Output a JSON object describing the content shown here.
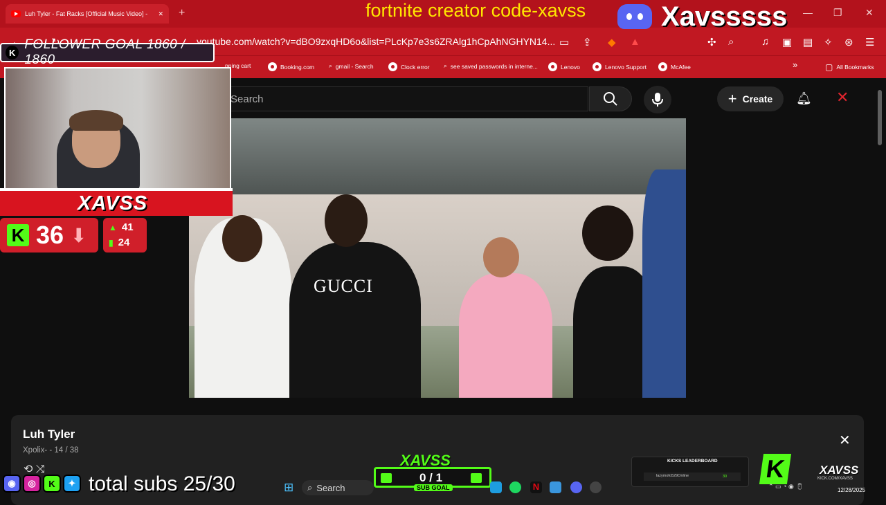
{
  "browser": {
    "tab_title": "Luh Tyler - Fat Racks [Official Music Video] -",
    "tab_close": "✕",
    "new_tab": "+",
    "url": "youtube.com/watch?v=dBO9zxqHD6o&list=PLcKp7e3s6ZRAlg1hCpAhNGHYN14...",
    "window_controls": [
      "—",
      "❐",
      "✕"
    ],
    "bookmarks": [
      "pping cart",
      "Booking.com",
      "gmail - Search",
      "Clock error",
      "see saved passwords in interne...",
      "Lenovo",
      "Lenovo Support",
      "McAfee"
    ],
    "bookmarks_more": "»",
    "all_bookmarks": "All Bookmarks"
  },
  "overlay": {
    "promo": "fortnite creator code-xavss",
    "discord_name": "Xavsssss",
    "follower_goal": "FOLLOWER GOAL 1860 / 1860",
    "kick_letter": "K",
    "banner_name": "XAVSS",
    "viewers": "36",
    "stat_up": "41",
    "stat_bars": "24",
    "total_subs": "total subs 25/30",
    "sub_goal_title": "XAVSS",
    "sub_goal_value": "0 / 1",
    "sub_goal_label": "SUB GOAL",
    "leaderboard_title": "KICKS LEADERBOARD",
    "leaderboard_row": "lazymofo529Online",
    "leaderboard_value": "30",
    "kick_plate_name": "XAVSS",
    "kick_plate_url": "KICK.COM/XAVSS"
  },
  "youtube": {
    "search_placeholder": "Search",
    "create_label": "Create",
    "video_shirt_text": "GUCCI",
    "playlist_title": "Luh Tyler",
    "playlist_sub": "Xpolix- - 14 / 38",
    "close": "✕"
  },
  "taskbar": {
    "search": "Search",
    "date": "12/28/2025"
  },
  "colors": {
    "chrome_red": "#c11822",
    "kick_green": "#53fc18",
    "promo_yellow": "#ffe600"
  }
}
